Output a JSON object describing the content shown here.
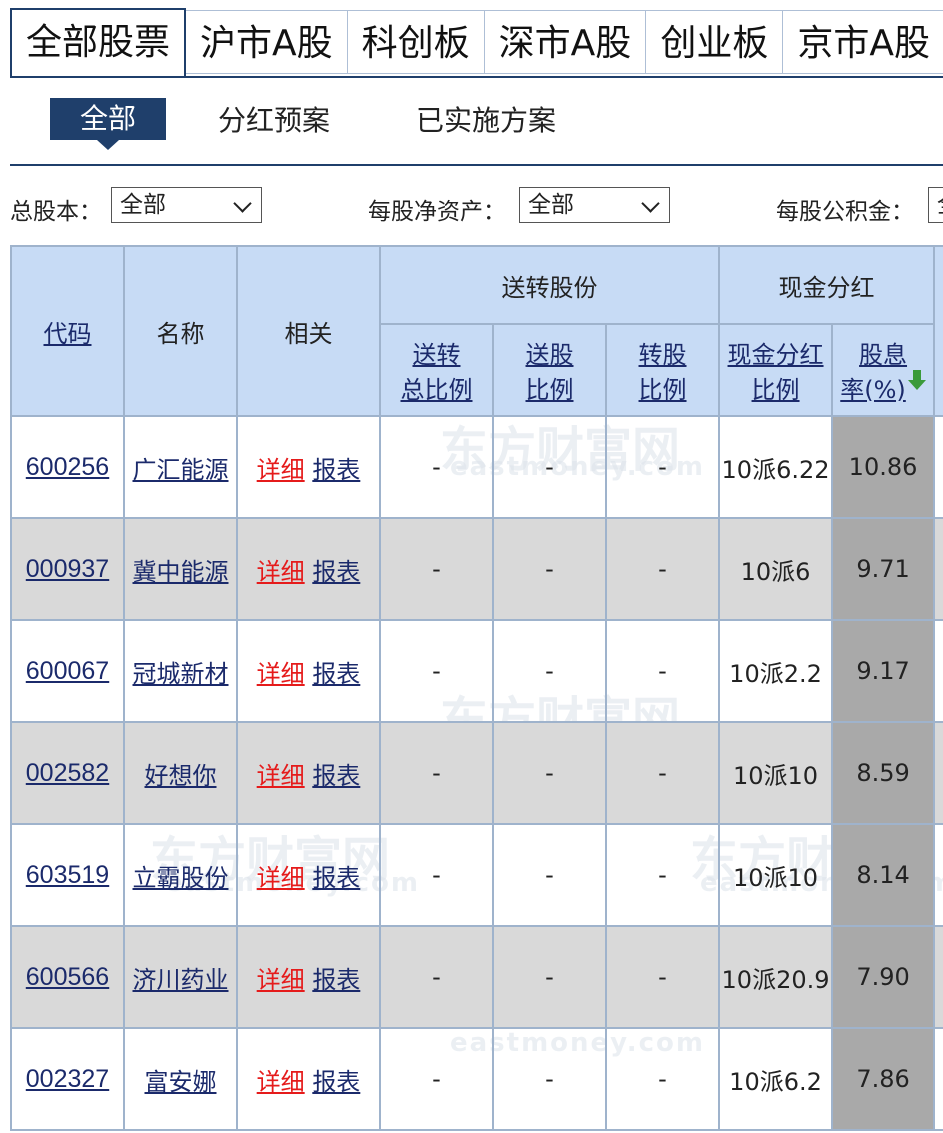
{
  "tabs": [
    "全部股票",
    "沪市A股",
    "科创板",
    "深市A股",
    "创业板",
    "京市A股"
  ],
  "subtabs": [
    "全部",
    "分红预案",
    "已实施方案"
  ],
  "filters": [
    {
      "label": "总股本：",
      "value": "全部"
    },
    {
      "label": "每股净资产：",
      "value": "全部"
    },
    {
      "label": "每股公积金：",
      "value": "全"
    }
  ],
  "table": {
    "headers": {
      "code": "代码",
      "name": "名称",
      "related": "相关",
      "group_bonus": "送转股份",
      "group_cash": "现金分红",
      "bonus_total_line1": "送转",
      "bonus_total_line2": "总比例",
      "bonus_stock_line1": "送股",
      "bonus_stock_line2": "比例",
      "transfer_line1": "转股",
      "transfer_line2": "比例",
      "cash_ratio_line1": "现金分红",
      "cash_ratio_line2": "比例",
      "yield_line1": "股息",
      "yield_line2": "率(%)"
    },
    "link_detail": "详细",
    "link_report": "报表",
    "rows": [
      {
        "code": "600256",
        "name": "广汇能源",
        "bonus_total": "-",
        "bonus_stock": "-",
        "transfer": "-",
        "cash": "10派6.22",
        "yield": "10.86"
      },
      {
        "code": "000937",
        "name": "冀中能源",
        "bonus_total": "-",
        "bonus_stock": "-",
        "transfer": "-",
        "cash": "10派6",
        "yield": "9.71"
      },
      {
        "code": "600067",
        "name": "冠城新材",
        "bonus_total": "-",
        "bonus_stock": "-",
        "transfer": "-",
        "cash": "10派2.2",
        "yield": "9.17"
      },
      {
        "code": "002582",
        "name": "好想你",
        "bonus_total": "-",
        "bonus_stock": "-",
        "transfer": "-",
        "cash": "10派10",
        "yield": "8.59"
      },
      {
        "code": "603519",
        "name": "立霸股份",
        "bonus_total": "-",
        "bonus_stock": "-",
        "transfer": "-",
        "cash": "10派10",
        "yield": "8.14"
      },
      {
        "code": "600566",
        "name": "济川药业",
        "bonus_total": "-",
        "bonus_stock": "-",
        "transfer": "-",
        "cash": "10派20.9",
        "yield": "7.90"
      },
      {
        "code": "002327",
        "name": "富安娜",
        "bonus_total": "-",
        "bonus_stock": "-",
        "transfer": "-",
        "cash": "10派6.2",
        "yield": "7.86"
      }
    ]
  },
  "watermark": {
    "cn": "东方财富网",
    "en": "eastmoney.com"
  },
  "colors": {
    "accent": "#1f3f6b",
    "header_bg": "#c7dbf5",
    "detail_link": "#e51b1b",
    "sort_arrow": "#3a9a3a"
  },
  "icons": {
    "sort": "arrow-down-icon",
    "dropdown": "chevron-down-icon"
  }
}
